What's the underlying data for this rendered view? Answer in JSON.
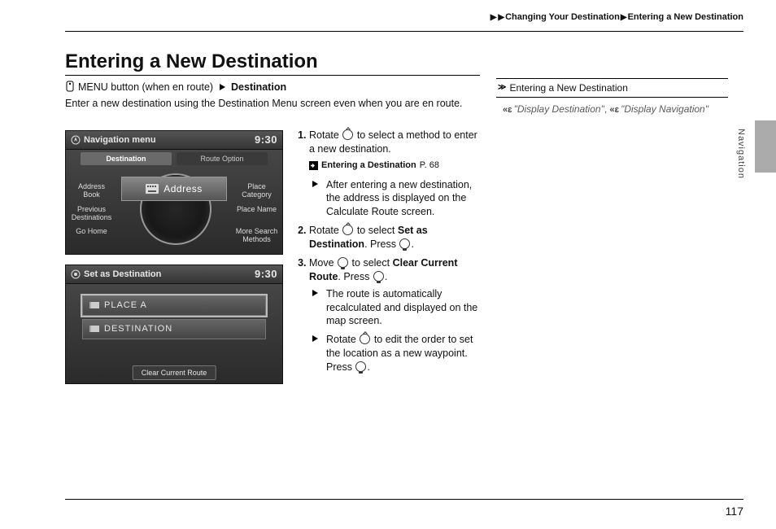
{
  "breadcrumb": {
    "a": "Changing Your Destination",
    "b": "Entering a New Destination"
  },
  "heading": "Entering a New Destination",
  "instructionPath": {
    "pre": "MENU button (when en route)",
    "dest": "Destination"
  },
  "intro": "Enter a new destination using the Destination Menu screen even when you are en route.",
  "screen1": {
    "title": "Navigation menu",
    "clock": "9:30",
    "tabs": {
      "a": "Destination",
      "b": "Route Option"
    },
    "center": "Address",
    "items": {
      "l1": "Address\nBook",
      "l2": "Previous\nDestinations",
      "l3": "Go Home",
      "r1": "Place\nCategory",
      "r2": "Place Name",
      "r3": "More Search\nMethods"
    }
  },
  "screen2": {
    "title": "Set as Destination",
    "clock": "9:30",
    "row1": "PLACE A",
    "row2": "DESTINATION",
    "bottom": "Clear Current Route"
  },
  "steps": {
    "s1": "Rotate",
    "s1b": "to select a method to enter a new destination.",
    "xref_label": "Entering a Destination",
    "xref_page": "P. 68",
    "s1_sub": "After entering a new destination, the address is displayed on the Calculate Route screen.",
    "s2a": "Rotate",
    "s2b": "to select",
    "s2_bold": "Set as Destination",
    "s2c": ". Press",
    "s2d": ".",
    "s3a": "Move",
    "s3b": "to select",
    "s3_bold": "Clear Current Route",
    "s3c": ". Press",
    "s3d": ".",
    "s3_sub1": "The route is automatically recalculated and displayed on the map screen.",
    "s3_sub2a": "Rotate",
    "s3_sub2b": "to edit the order to set the location as a new waypoint. Press",
    "s3_sub2c": "."
  },
  "sidebar": {
    "head": "Entering a New Destination",
    "voice1": "\"Display Destination\"",
    "voice_sep": ", ",
    "voice2": "\"Display Navigation\""
  },
  "sideLabel": "Navigation",
  "pageNum": "117"
}
